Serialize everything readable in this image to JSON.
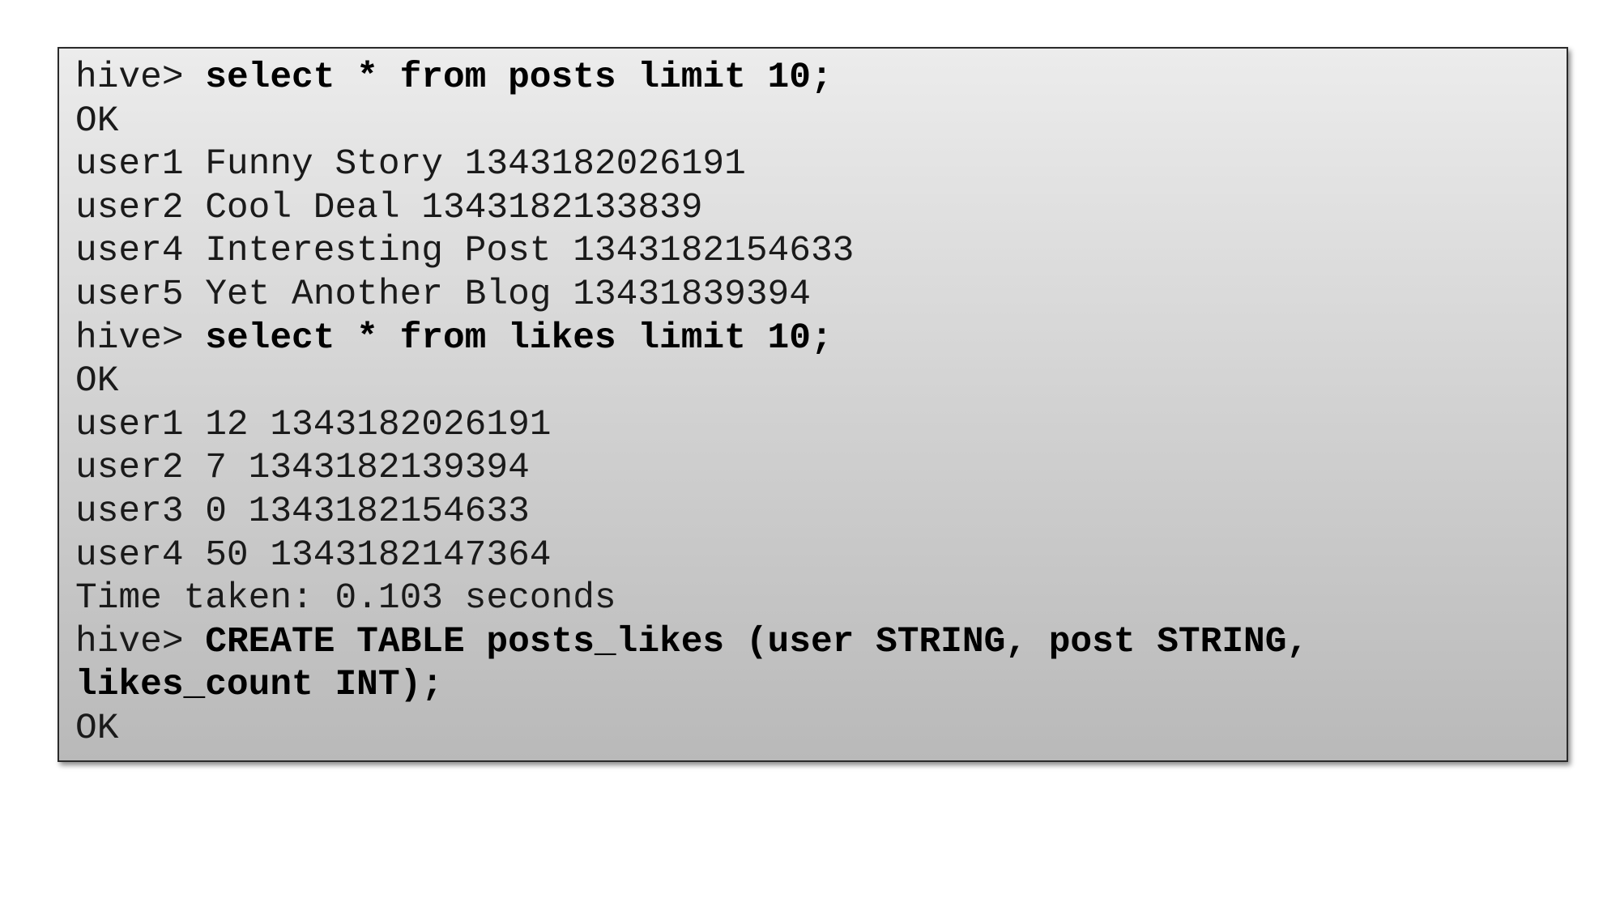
{
  "terminal": {
    "lines": [
      {
        "prompt": "hive> ",
        "command": "select * from posts limit 10;"
      },
      {
        "text": "OK"
      },
      {
        "text": "user1 Funny Story 1343182026191"
      },
      {
        "text": "user2 Cool Deal 1343182133839"
      },
      {
        "text": "user4 Interesting Post 1343182154633"
      },
      {
        "text": "user5 Yet Another Blog 13431839394"
      },
      {
        "prompt": "hive> ",
        "command": "select * from likes limit 10;"
      },
      {
        "text": "OK"
      },
      {
        "text": "user1 12 1343182026191"
      },
      {
        "text": "user2 7 1343182139394"
      },
      {
        "text": "user3 0 1343182154633"
      },
      {
        "text": "user4 50 1343182147364"
      },
      {
        "text": "Time taken: 0.103 seconds"
      },
      {
        "prompt": "hive> ",
        "command": "CREATE TABLE posts_likes (user STRING, post STRING,"
      },
      {
        "command": "likes_count INT);"
      },
      {
        "text": "OK"
      }
    ]
  }
}
